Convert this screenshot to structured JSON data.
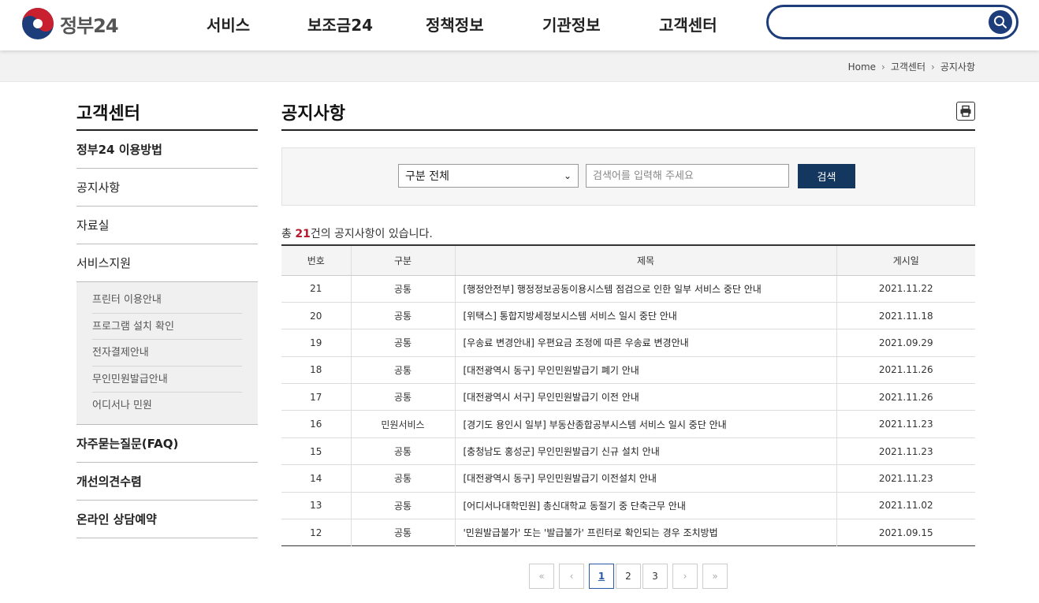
{
  "brand": {
    "name": "정부24"
  },
  "gnb": [
    {
      "label": "서비스"
    },
    {
      "label": "보조금24"
    },
    {
      "label": "정책정보"
    },
    {
      "label": "기관정보"
    },
    {
      "label": "고객센터"
    }
  ],
  "header_search": {
    "placeholder": "",
    "value": ""
  },
  "breadcrumb": [
    "Home",
    "고객센터",
    "공지사항"
  ],
  "sidebar": {
    "title": "고객센터",
    "items": [
      {
        "label": "정부24 이용방법"
      },
      {
        "label": "공지사항"
      },
      {
        "label": "자료실"
      },
      {
        "label": "서비스지원"
      }
    ],
    "sub_items": [
      {
        "label": "프린터 이용안내"
      },
      {
        "label": "프로그램 설치 확인"
      },
      {
        "label": "전자결제안내"
      },
      {
        "label": "무인민원발급안내"
      },
      {
        "label": "어디서나 민원"
      }
    ],
    "items_after": [
      {
        "label": "자주묻는질문(FAQ)"
      },
      {
        "label": "개선의견수렴"
      },
      {
        "label": "온라인 상담예약"
      }
    ]
  },
  "main": {
    "title": "공지사항",
    "filter": {
      "selected": "구분 전체",
      "placeholder": "검색어를 입력해 주세요",
      "button": "검색"
    },
    "count_prefix": "총 ",
    "count_num": "21",
    "count_suffix": "건의 공지사항이 있습니다.",
    "columns": [
      "번호",
      "구분",
      "제목",
      "게시일"
    ],
    "rows": [
      {
        "no": "21",
        "cat": "공통",
        "title": "[행정안전부] 행정정보공동이용시스템 점검으로 인한 일부 서비스 중단 안내",
        "date": "2021.11.22"
      },
      {
        "no": "20",
        "cat": "공통",
        "title": "[위택스] 통합지방세정보시스템 서비스 일시 중단 안내",
        "date": "2021.11.18"
      },
      {
        "no": "19",
        "cat": "공통",
        "title": "[우송료 변경안내] 우편요금 조정에 따른 우송료 변경안내",
        "date": "2021.09.29"
      },
      {
        "no": "18",
        "cat": "공통",
        "title": "[대전광역시 동구] 무인민원발급기 폐기 안내",
        "date": "2021.11.26"
      },
      {
        "no": "17",
        "cat": "공통",
        "title": "[대전광역시 서구] 무인민원발급기 이전 안내",
        "date": "2021.11.26"
      },
      {
        "no": "16",
        "cat": "민원서비스",
        "title": "[경기도 용인시 일부] 부동산종합공부시스템 서비스 일시 중단 안내",
        "date": "2021.11.23"
      },
      {
        "no": "15",
        "cat": "공통",
        "title": "[충청남도 홍성군] 무인민원발급기 신규 설치 안내",
        "date": "2021.11.23"
      },
      {
        "no": "14",
        "cat": "공통",
        "title": "[대전광역시 동구] 무인민원발급기 이전설치 안내",
        "date": "2021.11.23"
      },
      {
        "no": "13",
        "cat": "공통",
        "title": "[어디서나대학민원] 총신대학교 동절기 중 단축근무 안내",
        "date": "2021.11.02"
      },
      {
        "no": "12",
        "cat": "공통",
        "title": "'민원발급불가' 또는 '발급불가' 프린터로 확인되는 경우 조치방법",
        "date": "2021.09.15"
      }
    ]
  },
  "pager": {
    "first": "«",
    "prev": "‹",
    "pages": [
      "1",
      "2",
      "3"
    ],
    "current": "1",
    "next": "›",
    "last": "»"
  },
  "colors": {
    "brand_navy": "#1d3d7a",
    "button_navy": "#14375f",
    "count_red": "#b3182b"
  }
}
